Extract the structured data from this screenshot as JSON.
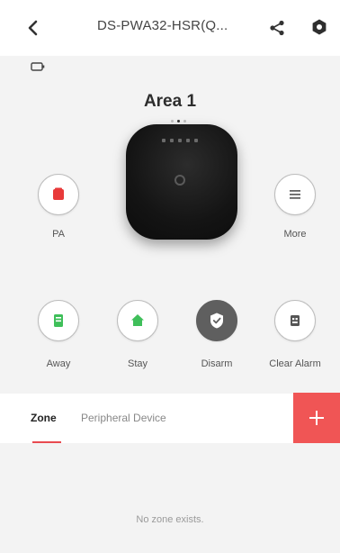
{
  "header": {
    "title": "DS-PWA32-HSR(Q...",
    "back_icon": "chevron-left-icon",
    "share_icon": "share-icon",
    "settings_icon": "settings-icon"
  },
  "status": {
    "battery_icon": "battery-icon"
  },
  "area": {
    "title": "Area 1"
  },
  "hub": {
    "image": "control-panel-hub"
  },
  "actions": {
    "pa": {
      "label": "PA",
      "icon": "red-device-icon",
      "color": "#e83a3a"
    },
    "more": {
      "label": "More",
      "icon": "list-icon"
    },
    "away": {
      "label": "Away",
      "icon": "away-arm-icon",
      "color": "#3fbf5a"
    },
    "stay": {
      "label": "Stay",
      "icon": "home-icon",
      "color": "#3fbf5a"
    },
    "disarm": {
      "label": "Disarm",
      "icon": "shield-check-icon"
    },
    "clear_alarm": {
      "label": "Clear Alarm",
      "icon": "alarm-clear-icon"
    }
  },
  "tabs": [
    {
      "label": "Zone",
      "active": true
    },
    {
      "label": "Peripheral Device",
      "active": false
    }
  ],
  "add_button": {
    "icon": "plus-icon",
    "color": "#f05555"
  },
  "zone_list": {
    "empty_message": "No zone exists."
  }
}
